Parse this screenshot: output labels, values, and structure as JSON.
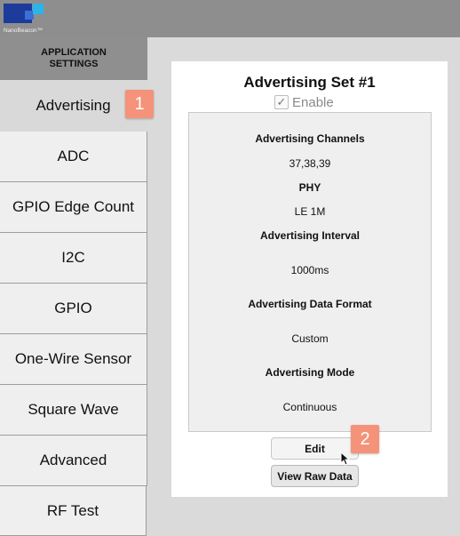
{
  "brand": {
    "logo_text": "NanoBeacon™",
    "colors": {
      "dark_blue": "#1c3b9a",
      "light_blue": "#2bb4ec"
    }
  },
  "sidebar": {
    "header": "APPLICATION SETTINGS",
    "items": [
      {
        "label": "Advertising",
        "active": true
      },
      {
        "label": "ADC"
      },
      {
        "label": "GPIO Edge Count"
      },
      {
        "label": "I2C"
      },
      {
        "label": "GPIO"
      },
      {
        "label": "One-Wire Sensor"
      },
      {
        "label": "Square Wave"
      },
      {
        "label": "Advanced"
      },
      {
        "label": "RF Test"
      }
    ]
  },
  "badges": {
    "first": "1",
    "second": "2",
    "color": "#f4937a"
  },
  "panel": {
    "title": "Advertising Set #1",
    "enable_label": "Enable",
    "enable_checked": true,
    "check_glyph": "✓",
    "fields": {
      "channels_label": "Advertising Channels",
      "channels_value": "37,38,39",
      "phy_label": "PHY",
      "phy_value": "LE 1M",
      "interval_label": "Advertising Interval",
      "interval_value": "1000ms",
      "format_label": "Advertising Data Format",
      "format_value": "Custom",
      "mode_label": "Advertising Mode",
      "mode_value": "Continuous"
    },
    "edit_button": "Edit",
    "raw_button": "View Raw Data"
  }
}
